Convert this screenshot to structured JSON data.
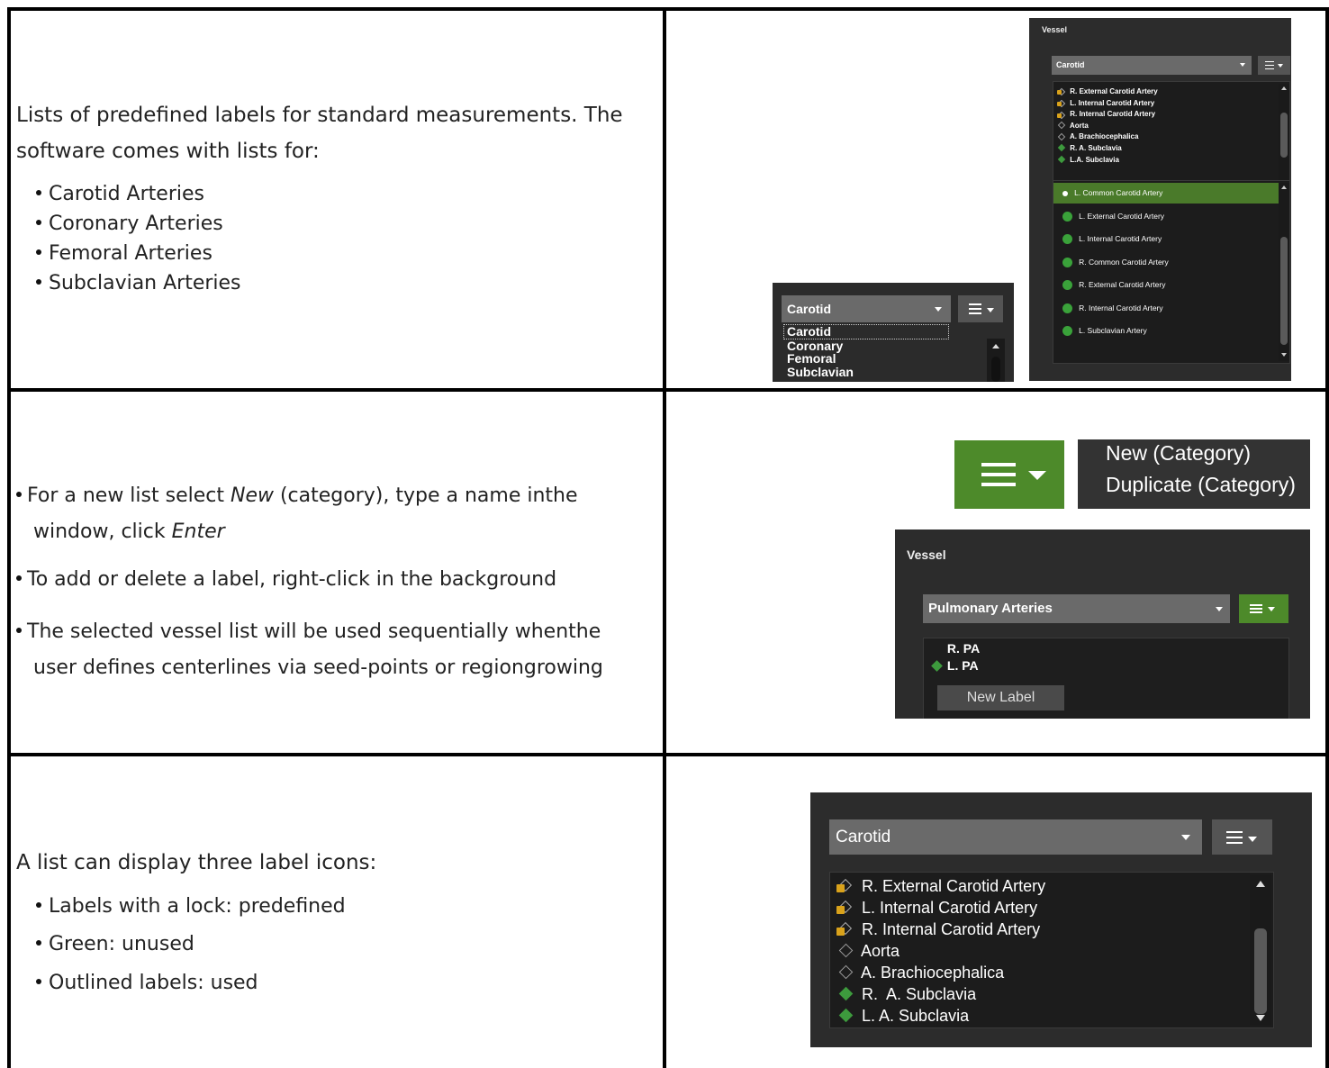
{
  "row1": {
    "intro": "Lists of predefined labels for standard measurements. The software comes with lists for:",
    "bullets": [
      "Carotid Arteries",
      "Coronary Arteries",
      "Femoral Arteries",
      "Subclavian Arteries"
    ]
  },
  "row1_dropdown": {
    "selected": "Carotid",
    "options": [
      "Carotid",
      "Coronary",
      "Femoral",
      "Subclavian"
    ]
  },
  "row1_panel": {
    "title": "Vessel",
    "category": "Carotid",
    "labels": [
      {
        "text": "R. External Carotid Artery",
        "icon": "lock-tag-icon"
      },
      {
        "text": "L. Internal Carotid Artery",
        "icon": "lock-tag-icon"
      },
      {
        "text": "R. Internal Carotid Artery",
        "icon": "lock-tag-icon"
      },
      {
        "text": "Aorta",
        "icon": "outline-tag-icon"
      },
      {
        "text": "A. Brachiocephalica",
        "icon": "outline-tag-icon"
      },
      {
        "text": "R. A. Subclavia",
        "icon": "green-tag-icon"
      },
      {
        "text": "L.A. Subclavia",
        "icon": "green-tag-icon"
      }
    ],
    "centerlines": [
      "L. Common Carotid Artery",
      "L. External Carotid Artery",
      "L. Internal Carotid Artery",
      "R. Common Carotid Artery",
      "R. External Carotid Artery",
      "R. Internal Carotid Artery",
      "L. Subclavian Artery"
    ],
    "selected_centerline": 0
  },
  "row2": {
    "b1_pre": "For a new list select ",
    "b1_em1": "New",
    "b1_mid": " (category), type a name inthe",
    "b1_l2_pre": "window, click ",
    "b1_em2": "Enter",
    "b2": "To add or delete a label, right-click in the background",
    "b3_l1": "The selected vessel list will be used sequentially whenthe",
    "b3_l2": "user defines centerlines via seed-points or regiongrowing"
  },
  "row2_menu": {
    "items": [
      "New (Category)",
      "Duplicate (Category)"
    ]
  },
  "row2_panel": {
    "title": "Vessel",
    "category": "Pulmonary Arteries",
    "labels": [
      "R. PA",
      "L. PA"
    ],
    "new_label_button": "New Label"
  },
  "row3": {
    "intro": "A list can display three label icons:",
    "bullets": [
      "Labels with a lock: predefined",
      "Green: unused",
      "Outlined labels: used"
    ]
  },
  "row3_panel": {
    "category": "Carotid",
    "labels": [
      {
        "text": "R. External Carotid Artery",
        "icon": "lock-tag-icon"
      },
      {
        "text": "L. Internal Carotid Artery",
        "icon": "lock-tag-icon"
      },
      {
        "text": "R. Internal Carotid Artery",
        "icon": "lock-tag-icon"
      },
      {
        "text": "Aorta",
        "icon": "outline-tag-icon"
      },
      {
        "text": "A. Brachiocephalica",
        "icon": "outline-tag-icon"
      },
      {
        "text": "R.  A. Subclavia",
        "icon": "green-tag-icon"
      },
      {
        "text": "L. A. Subclavia",
        "icon": "green-tag-icon"
      }
    ]
  },
  "colors": {
    "green_accent": "#4d8a2a",
    "selected_row": "#4a7a2a",
    "panel_bg": "#2e2e2e",
    "lock": "#d9a21b",
    "tag_green": "#3d9a3d"
  }
}
